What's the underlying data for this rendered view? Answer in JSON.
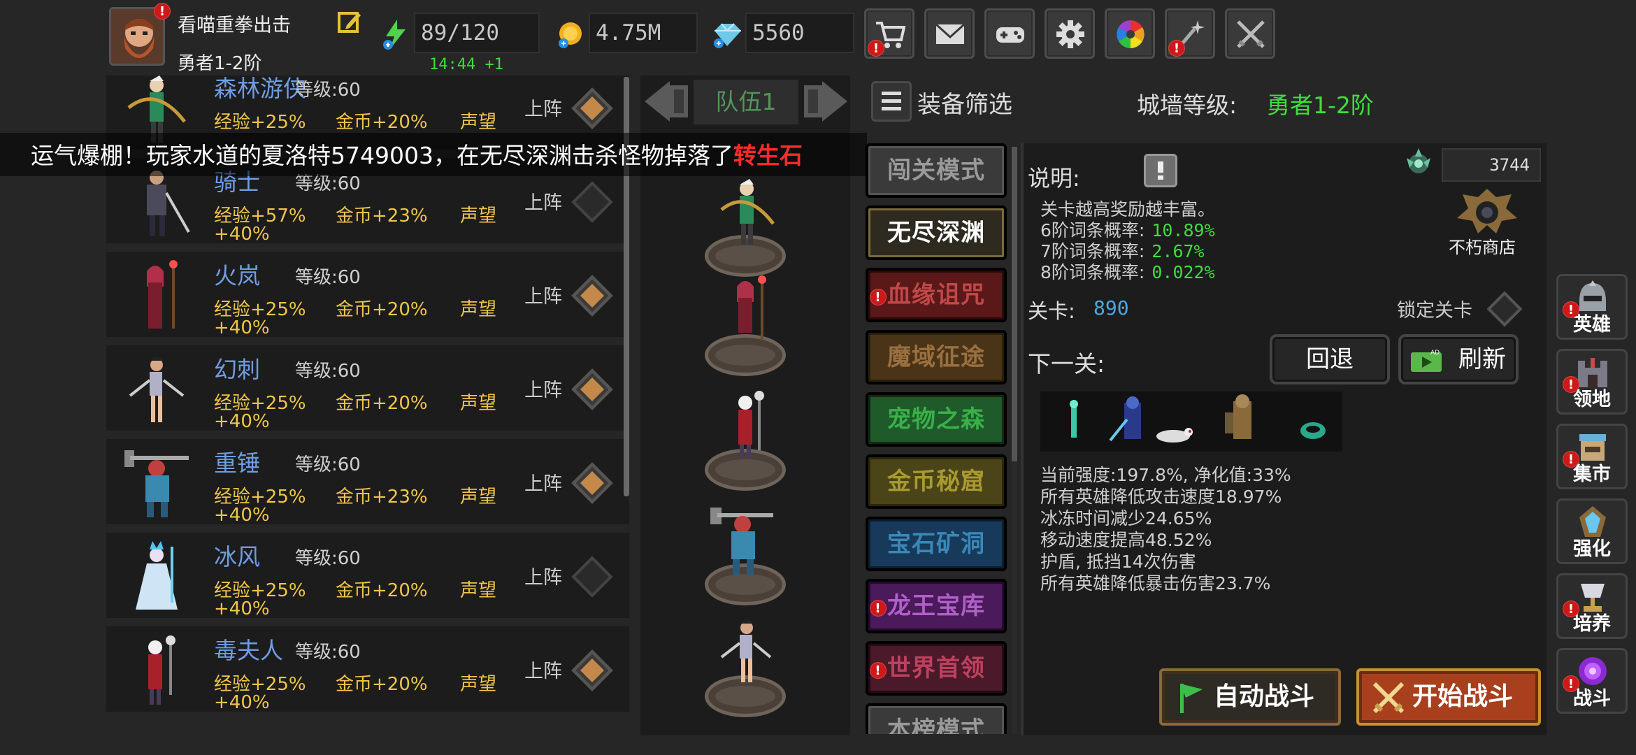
{
  "player": {
    "name": "看喵重拳出击",
    "rank": "勇者1-2阶"
  },
  "resources": {
    "energy": "89/120",
    "energy_timer": "14:44 +1",
    "gold": "4.75M",
    "gems": "5560"
  },
  "top_icons": [
    "cart-icon",
    "mail-icon",
    "gamepad-icon",
    "gear-icon",
    "color-wheel-icon",
    "sparkle-icon",
    "crossed-swords-icon"
  ],
  "hero_list": [
    {
      "name": "森林游侠",
      "level": "等级:60",
      "exp": "经验+25%",
      "gold": "金币+20%",
      "rep": "声望",
      "extra": "",
      "deploy": "上阵",
      "deployed": true
    },
    {
      "name": "骑士",
      "level": "等级:60",
      "exp": "经验+57%",
      "gold": "金币+23%",
      "rep": "声望",
      "extra": "+40%",
      "deploy": "上阵",
      "deployed": false
    },
    {
      "name": "火岚",
      "level": "等级:60",
      "exp": "经验+25%",
      "gold": "金币+20%",
      "rep": "声望",
      "extra": "+40%",
      "deploy": "上阵",
      "deployed": true
    },
    {
      "name": "幻刺",
      "level": "等级:60",
      "exp": "经验+25%",
      "gold": "金币+20%",
      "rep": "声望",
      "extra": "+40%",
      "deploy": "上阵",
      "deployed": true
    },
    {
      "name": "重锤",
      "level": "等级:60",
      "exp": "经验+25%",
      "gold": "金币+23%",
      "rep": "声望",
      "extra": "+40%",
      "deploy": "上阵",
      "deployed": true
    },
    {
      "name": "冰风",
      "level": "等级:60",
      "exp": "经验+25%",
      "gold": "金币+20%",
      "rep": "声望",
      "extra": "+40%",
      "deploy": "上阵",
      "deployed": false
    },
    {
      "name": "毒夫人",
      "level": "等级:60",
      "exp": "经验+25%",
      "gold": "金币+20%",
      "rep": "声望",
      "extra": "+40%",
      "deploy": "上阵",
      "deployed": true
    }
  ],
  "marquee": {
    "text": "运气爆棚！玩家水道的夏洛特5749003，在无尽深渊击杀怪物掉落了",
    "highlight": "转生石"
  },
  "team": {
    "label": "队伍1"
  },
  "filter": {
    "label": "装备筛选"
  },
  "wall": {
    "label": "城墙等级:",
    "value": "勇者1-2阶"
  },
  "modes": [
    {
      "label": "闯关模式",
      "alert": false
    },
    {
      "label": "无尽深渊",
      "alert": false
    },
    {
      "label": "血缘诅咒",
      "alert": true
    },
    {
      "label": "魔域征途",
      "alert": false
    },
    {
      "label": "宠物之森",
      "alert": false
    },
    {
      "label": "金币秘窟",
      "alert": false
    },
    {
      "label": "宝石矿洞",
      "alert": false
    },
    {
      "label": "龙王宝库",
      "alert": true
    },
    {
      "label": "世界首领",
      "alert": true
    },
    {
      "label": "本榜模式",
      "alert": false
    }
  ],
  "info": {
    "desc_label": "说明:",
    "currency_value": "3744",
    "shop_label": "不朽商店",
    "desc_lines": [
      {
        "text": "关卡越高奖励越丰富。",
        "val": ""
      },
      {
        "text": "6阶词条概率:",
        "val": "10.89%"
      },
      {
        "text": "7阶词条概率:",
        "val": "2.67%"
      },
      {
        "text": "8阶词条概率:",
        "val": "0.022%"
      }
    ],
    "stage_label": "关卡:",
    "stage_value": "890",
    "lock_label": "锁定关卡",
    "next_label": "下一关:",
    "back_label": "回退",
    "refresh_label": "刷新",
    "buff_lines": [
      "当前强度:197.8%, 净化值:33%",
      "所有英雄降低攻击速度18.97%",
      "冰冻时间减少24.65%",
      "移动速度提高48.52%",
      "护盾, 抵挡14次伤害",
      "所有英雄降低暴击伤害23.7%"
    ],
    "auto_label": "自动战斗",
    "start_label": "开始战斗"
  },
  "side_nav": [
    {
      "label": "英雄",
      "icon": "helmet-icon",
      "alert": true
    },
    {
      "label": "领地",
      "icon": "castle-icon",
      "alert": true
    },
    {
      "label": "集市",
      "icon": "market-icon",
      "alert": true
    },
    {
      "label": "强化",
      "icon": "crystal-icon",
      "alert": false
    },
    {
      "label": "培养",
      "icon": "chalice-icon",
      "alert": true
    },
    {
      "label": "战斗",
      "icon": "portal-icon",
      "alert": true
    }
  ]
}
